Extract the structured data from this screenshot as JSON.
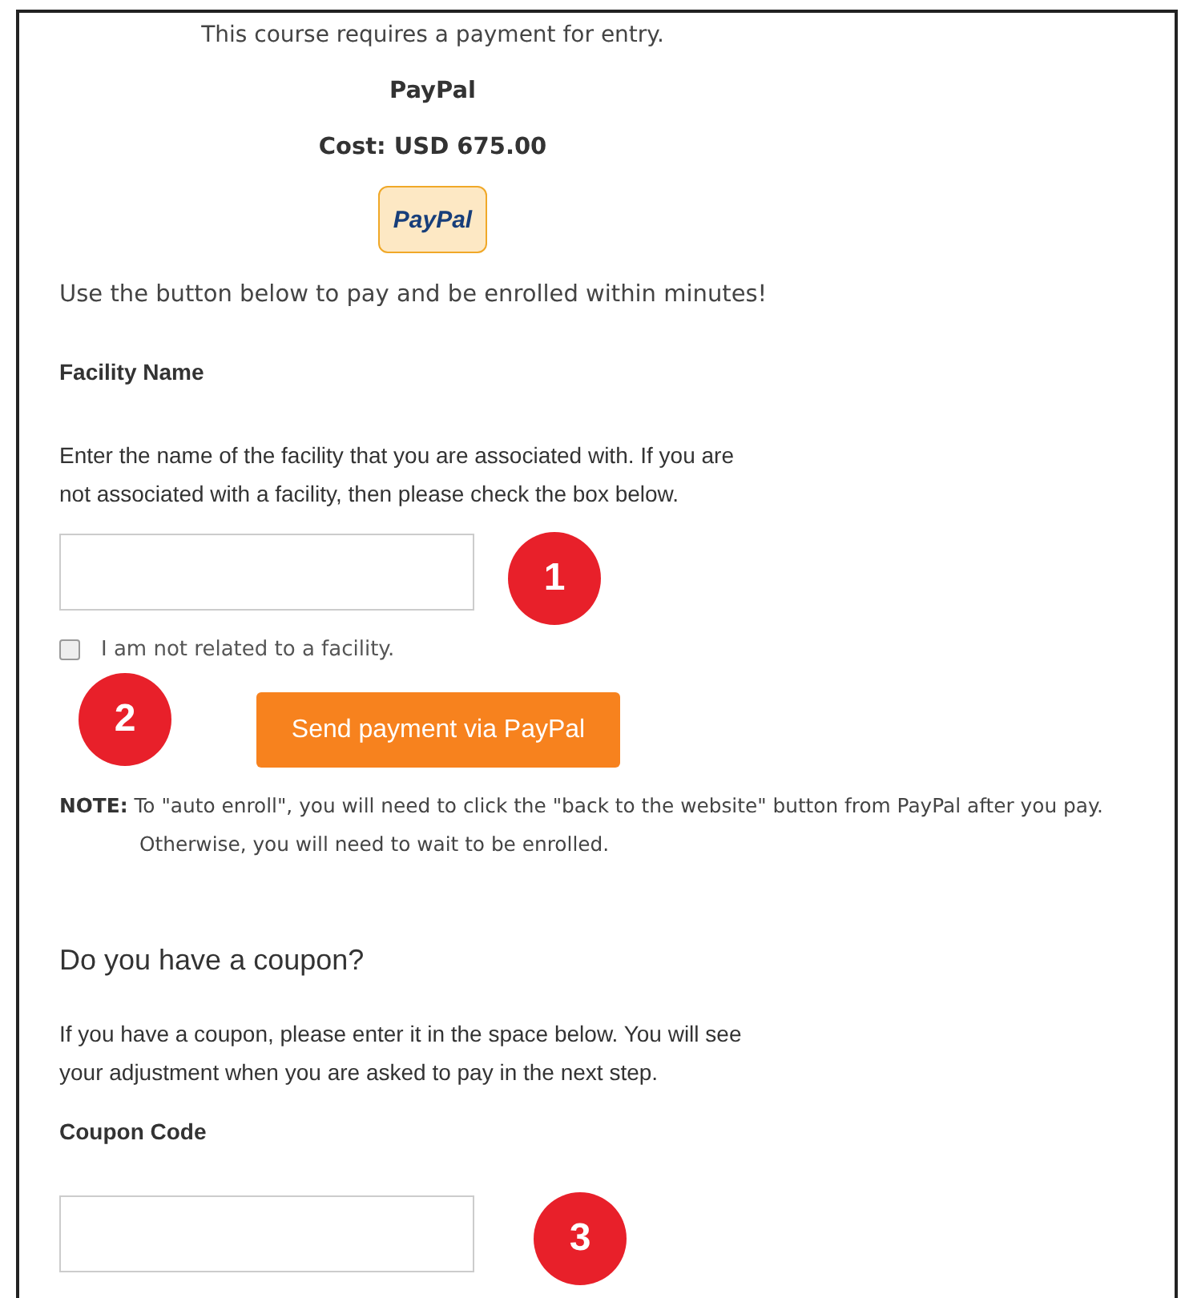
{
  "intro": "This course requires a payment for entry.",
  "method": "PayPal",
  "cost": "Cost: USD 675.00",
  "logo": "PayPal",
  "instruction": "Use the button below to pay and be enrolled within minutes!",
  "facility": {
    "heading": "Facility Name",
    "help": "Enter the name of the facility that you are associated with. If you are not associated with a facility, then please check the box below.",
    "checkbox": {
      "label": "I am not related to a facility.",
      "checked": false
    }
  },
  "pay_button": "Send payment via PayPal",
  "note": [
    "**NOTE:** To \"auto enroll\", you will need to click the \"back to the website\" button from PayPal after you pay.",
    "Otherwise, you will need to wait to be enrolled."
  ],
  "coupon": {
    "heading": "Do you have a coupon?",
    "help": "If you have a coupon, please enter it in the space below. You will see your adjustment when you are asked to pay in the next step.",
    "label": "Coupon Code"
  },
  "callouts": [
    "1",
    "2",
    "3"
  ]
}
